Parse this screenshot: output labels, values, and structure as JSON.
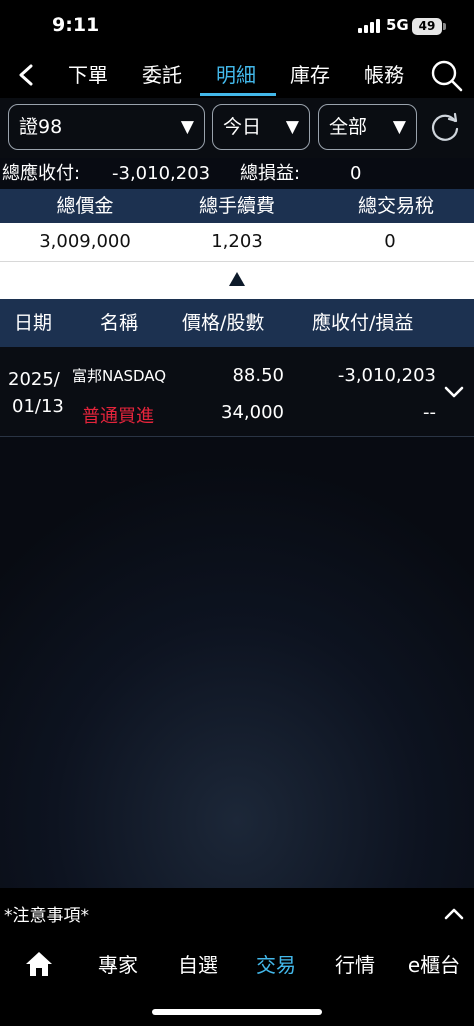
{
  "status": {
    "time": "9:11",
    "network": "5G",
    "battery": "49"
  },
  "nav": {
    "tabs": [
      {
        "label": "下單"
      },
      {
        "label": "委託"
      },
      {
        "label": "明細"
      },
      {
        "label": "庫存"
      },
      {
        "label": "帳務"
      }
    ],
    "active_tab": "明細"
  },
  "filters": {
    "account": "證98",
    "period": "今日",
    "type": "全部"
  },
  "summary": {
    "receivable_label": "總應收付:",
    "receivable_value": "-3,010,203",
    "pnl_label": "總損益:",
    "pnl_value": "0"
  },
  "totals": {
    "headers": [
      "總價金",
      "總手續費",
      "總交易稅"
    ],
    "values": [
      "3,009,000",
      "1,203",
      "0"
    ]
  },
  "list": {
    "headers": [
      "日期",
      "名稱",
      "價格/股數",
      "應收付/損益"
    ],
    "rows": [
      {
        "date_line1": "2025/",
        "date_line2": "01/13",
        "name": "富邦NASDAQ",
        "action": "普通買進",
        "price": "88.50",
        "shares": "34,000",
        "receivable": "-3,010,203",
        "pnl": "--"
      }
    ]
  },
  "footer": {
    "notice": "*注意事項*",
    "tabs": [
      {
        "label": "專家"
      },
      {
        "label": "自選"
      },
      {
        "label": "交易"
      },
      {
        "label": "行情"
      },
      {
        "label": "e櫃台"
      }
    ],
    "active_tab": "交易"
  },
  "colors": {
    "accent": "#43b8ea",
    "header_bg": "#1c3150",
    "buy_red": "#e5243b"
  }
}
